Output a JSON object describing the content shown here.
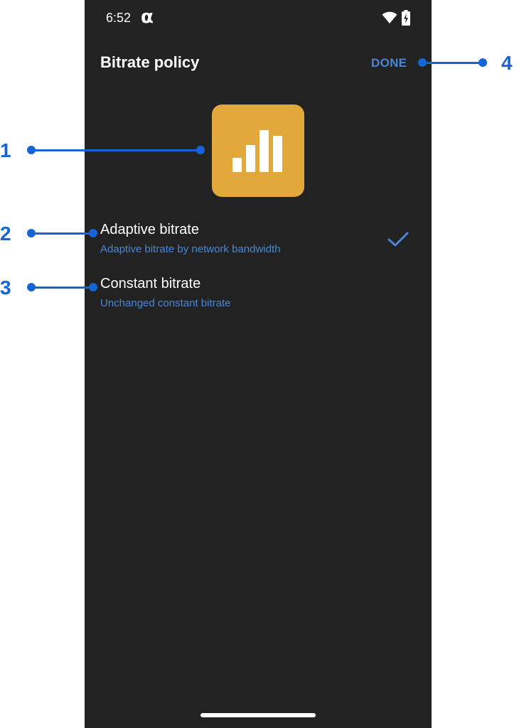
{
  "status_bar": {
    "time": "6:52",
    "app_glyph": "α",
    "icons": [
      "wifi-icon",
      "battery-charging-icon"
    ]
  },
  "header": {
    "title": "Bitrate policy",
    "done_label": "DONE"
  },
  "hero": {
    "icon": "bitrate-bars-icon",
    "color": "#e3a83c"
  },
  "options": [
    {
      "label": "Adaptive bitrate",
      "subtitle": "Adaptive bitrate by network bandwidth",
      "selected": true
    },
    {
      "label": "Constant bitrate",
      "subtitle": "Unchanged constant bitrate",
      "selected": false
    }
  ],
  "callouts": {
    "c1": "1",
    "c2": "2",
    "c3": "3",
    "c4": "4"
  },
  "colors": {
    "background": "#222222",
    "accent": "#4a86d8",
    "callout": "#1565d8"
  }
}
